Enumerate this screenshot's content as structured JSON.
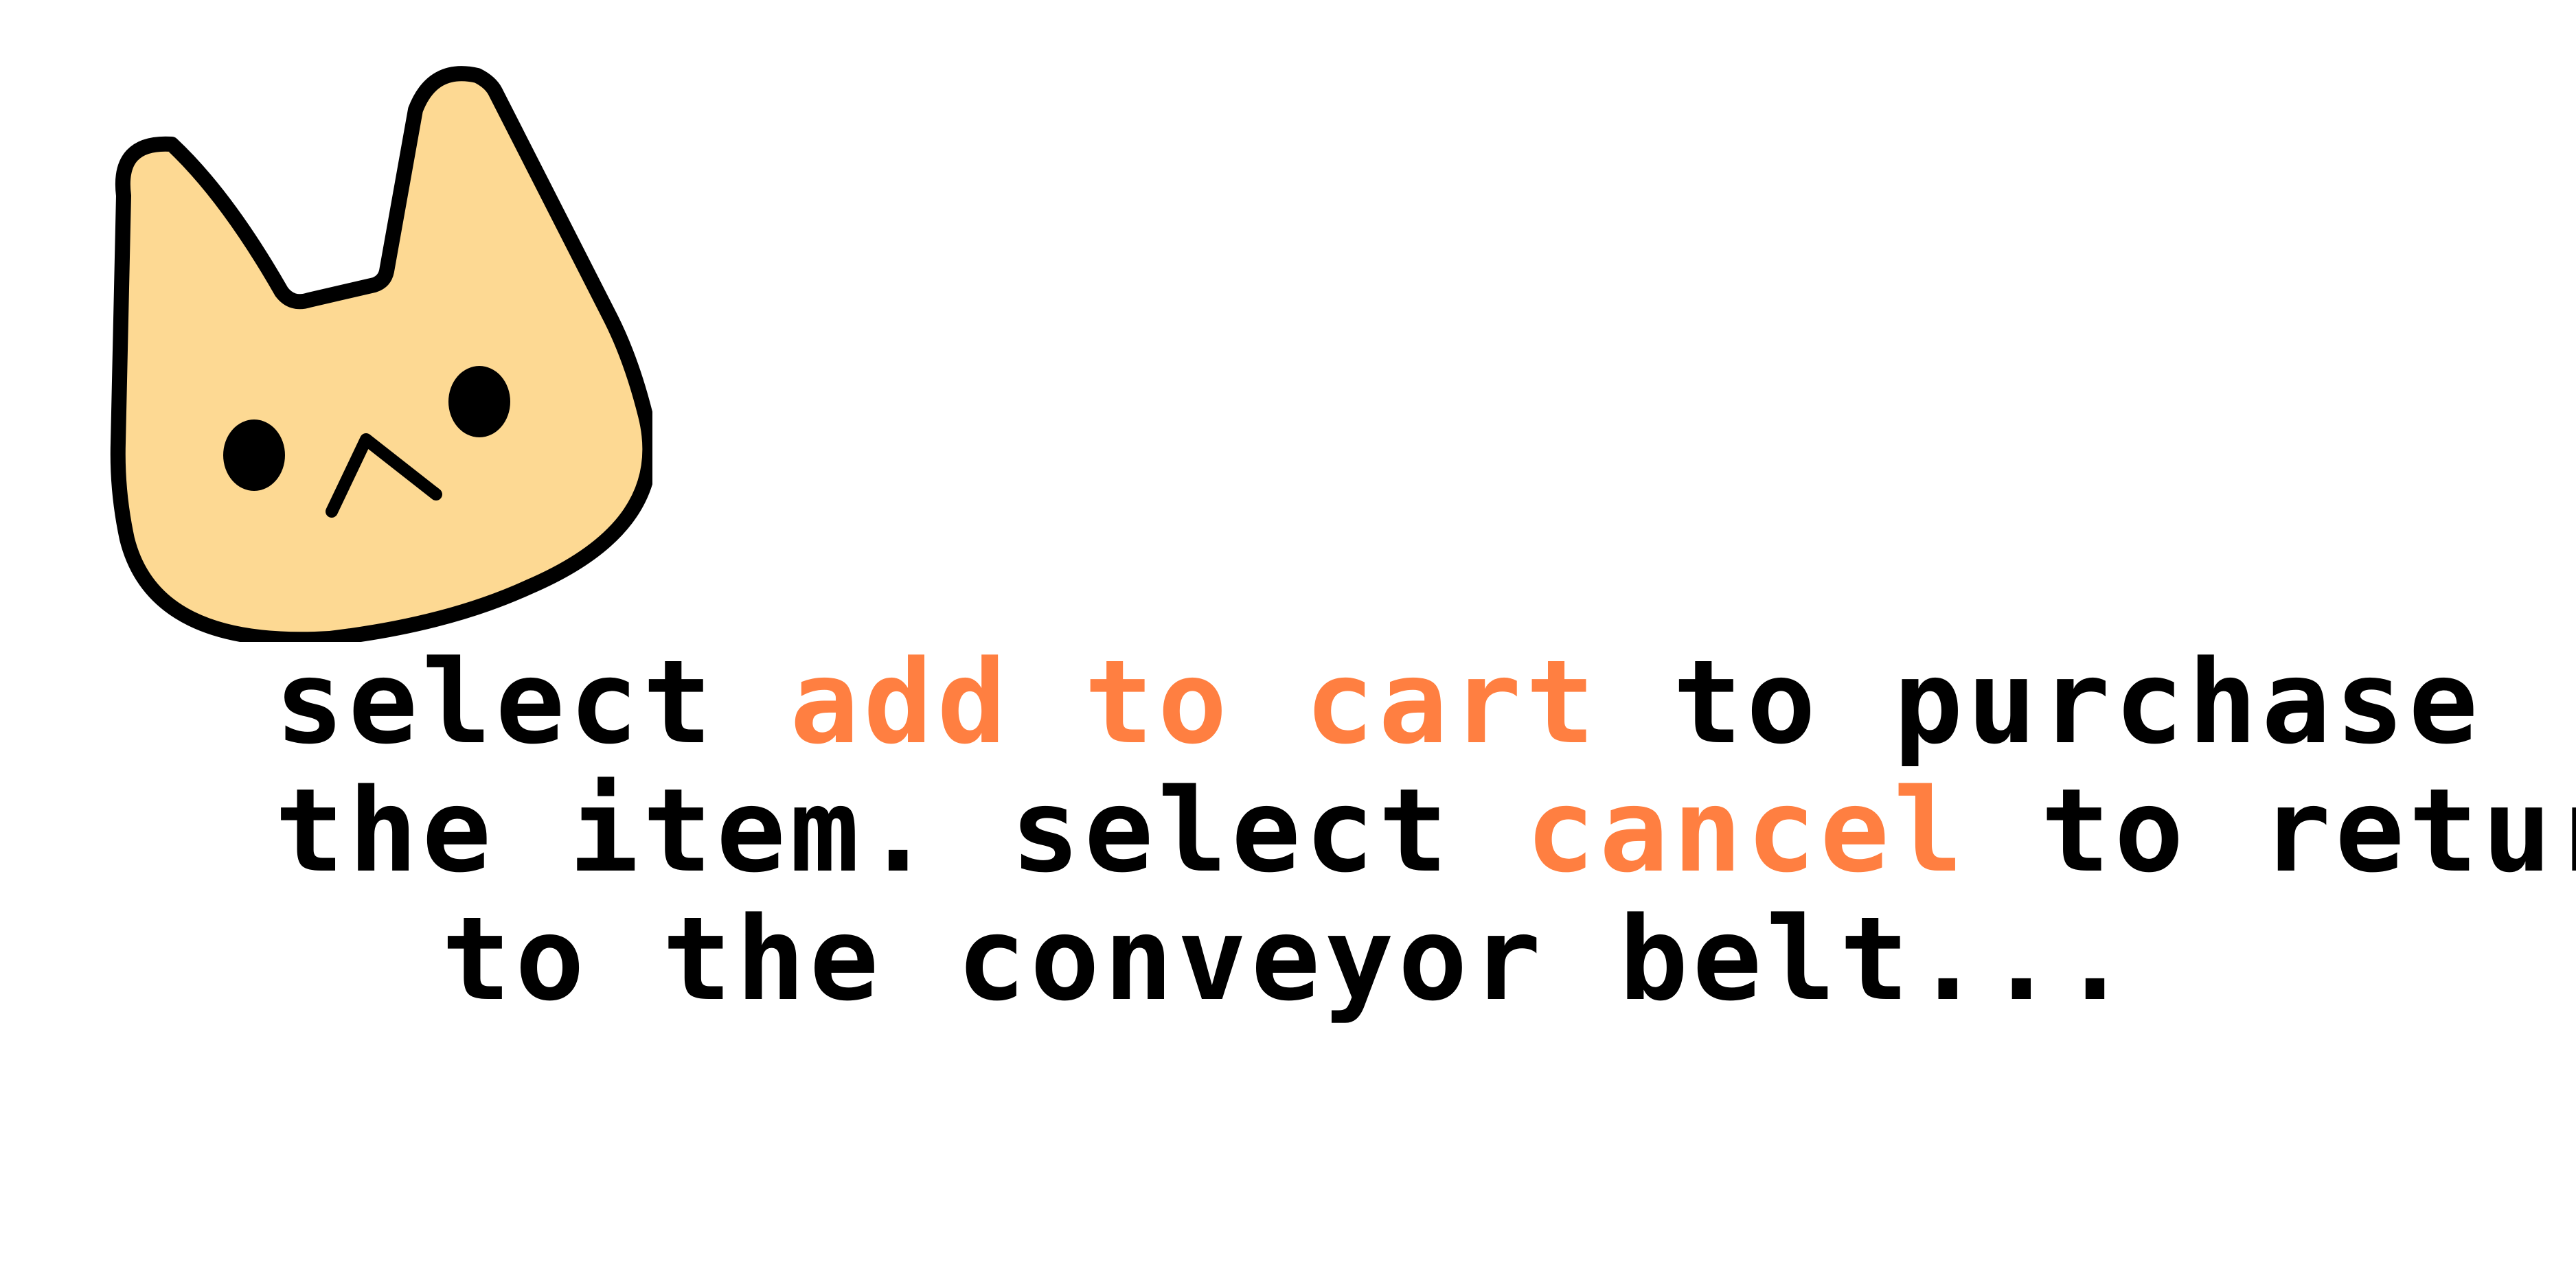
{
  "mascot": {
    "icon": "cat-face-icon",
    "fill": "#fdd993",
    "stroke": "#000000"
  },
  "dialog": {
    "lines": [
      {
        "before": "select ",
        "highlight": "add to cart",
        "after": " to purchase"
      },
      {
        "before": "the item. select ",
        "highlight": "cancel",
        "after": " to return"
      },
      {
        "before": "to the conveyor belt..."
      }
    ]
  },
  "colors": {
    "text": "#000000",
    "highlight": "#ff7f41",
    "background": "#ffffff"
  }
}
